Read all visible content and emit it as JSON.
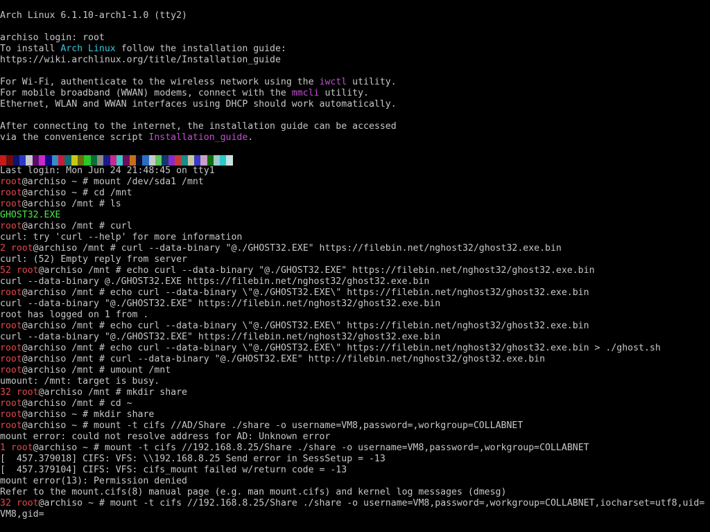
{
  "colors": {
    "text": "#c8c8c8",
    "background": "#000000",
    "prompt_user": "#e5484d",
    "exit_code": "#e5484d",
    "directory_entry": "#4ee84e",
    "distro_highlight": "#38c6d9",
    "utility_highlight": "#c050d0"
  },
  "banner": {
    "kernel": "Arch Linux 6.1.10-arch1-1.0 (tty2)",
    "login": "archiso login: root",
    "install_pre": "To install ",
    "install_distro": "Arch Linux",
    "install_post": " follow the installation guide:",
    "guide_url": "https://wiki.archlinux.org/title/Installation_guide",
    "wifi_pre": "For Wi-Fi, authenticate to the wireless network using the ",
    "wifi_tool": "iwctl",
    "wifi_post": " utility.",
    "wwan_pre": "For mobile broadband (WWAN) modems, connect with the ",
    "wwan_tool": "mmcli",
    "wwan_post": " utility.",
    "ethernet": "Ethernet, WLAN and WWAN interfaces using DHCP should work automatically.",
    "after_1": "After connecting to the internet, the installation guide can be accessed",
    "after_2_pre": "via the convenience script ",
    "after_2_tool": "Installation_guide",
    "after_2_post": "."
  },
  "palette_swatches": [
    "#c41a1a",
    "#6d0c0c",
    "#0c146d",
    "#2a3ac8",
    "#c8c8c8",
    "#5a0c6d",
    "#c82ac8",
    "#0c0c8a",
    "#3a8ac8",
    "#c81a3a",
    "#0c6d6d",
    "#c8c814",
    "#6d6d0c",
    "#2ac82a",
    "#0c6d3a",
    "#8a8a8a",
    "#1a1a8a",
    "#c82a8a",
    "#3ac8c8",
    "#6d0c5a",
    "#c86d1a",
    "#0c0c2a",
    "#2a6dc8",
    "#c8c8c8",
    "#5ac85a",
    "#0c3a6d",
    "#8a2ac8",
    "#c83a3a",
    "#1a8a8a",
    "#c8c8a0",
    "#3a3ac8",
    "#c8a0c8",
    "#0c6d0c",
    "#a0c8c8",
    "#2ac8c8",
    "#c8e0e0"
  ],
  "lines": [
    {
      "text": "Last login: Mon Jun 24 21:48:45 on tty1"
    },
    {
      "exit": "",
      "user": "root",
      "host": "@archiso",
      "cwd": " ~ ",
      "cmd": "# mount /dev/sda1 /mnt"
    },
    {
      "exit": "",
      "user": "root",
      "host": "@archiso",
      "cwd": " ~ ",
      "cmd": "# cd /mnt"
    },
    {
      "exit": "",
      "user": "root",
      "host": "@archiso",
      "cwd": " /mnt ",
      "cmd": "# ls"
    },
    {
      "entry": "GHOST32.EXE"
    },
    {
      "exit": "",
      "user": "root",
      "host": "@archiso",
      "cwd": " /mnt ",
      "cmd": "# curl"
    },
    {
      "text": "curl: try 'curl --help' for more information"
    },
    {
      "exit": "2 ",
      "user": "root",
      "host": "@archiso",
      "cwd": " /mnt ",
      "cmd": "# curl --data-binary \"@./GHOST32.EXE\" https://filebin.net/nghost32/ghost32.exe.bin"
    },
    {
      "text": "curl: (52) Empty reply from server"
    },
    {
      "exit": "52 ",
      "user": "root",
      "host": "@archiso",
      "cwd": " /mnt ",
      "cmd": "# echo curl --data-binary \"@./GHOST32.EXE\" https://filebin.net/nghost32/ghost32.exe.bin"
    },
    {
      "text": "curl --data-binary @./GHOST32.EXE https://filebin.net/nghost32/ghost32.exe.bin"
    },
    {
      "exit": "",
      "user": "root",
      "host": "@archiso",
      "cwd": " /mnt ",
      "cmd": "# echo curl --data-binary \\\"@./GHOST32.EXE\\\" https://filebin.net/nghost32/ghost32.exe.bin"
    },
    {
      "text": "curl --data-binary \"@./GHOST32.EXE\" https://filebin.net/nghost32/ghost32.exe.bin"
    },
    {
      "text": "root has logged on 1 from ."
    },
    {
      "exit": "",
      "user": "root",
      "host": "@archiso",
      "cwd": " /mnt ",
      "cmd": "# echo curl --data-binary \\\"@./GHOST32.EXE\\\" https://filebin.net/nghost32/ghost32.exe.bin"
    },
    {
      "text": "curl --data-binary \"@./GHOST32.EXE\" https://filebin.net/nghost32/ghost32.exe.bin"
    },
    {
      "exit": "",
      "user": "root",
      "host": "@archiso",
      "cwd": " /mnt ",
      "cmd": "# echo curl --data-binary \\\"@./GHOST32.EXE\\\" https://filebin.net/nghost32/ghost32.exe.bin > ./ghost.sh"
    },
    {
      "exit": "",
      "user": "root",
      "host": "@archiso",
      "cwd": " /mnt ",
      "cmd": "# curl --data-binary \"@./GHOST32.EXE\" http://filebin.net/nghost32/ghost32.exe.bin"
    },
    {
      "exit": "",
      "user": "root",
      "host": "@archiso",
      "cwd": " /mnt ",
      "cmd": "# umount /mnt"
    },
    {
      "text": "umount: /mnt: target is busy."
    },
    {
      "exit": "32 ",
      "user": "root",
      "host": "@archiso",
      "cwd": " /mnt ",
      "cmd": "# mkdir share"
    },
    {
      "exit": "",
      "user": "root",
      "host": "@archiso",
      "cwd": " /mnt ",
      "cmd": "# cd ~"
    },
    {
      "exit": "",
      "user": "root",
      "host": "@archiso",
      "cwd": " ~ ",
      "cmd": "# mkdir share"
    },
    {
      "exit": "",
      "user": "root",
      "host": "@archiso",
      "cwd": " ~ ",
      "cmd": "# mount -t cifs //AD/Share ./share -o username=VM8,password=,workgroup=COLLABNET"
    },
    {
      "text": "mount error: could not resolve address for AD: Unknown error"
    },
    {
      "exit": "1 ",
      "user": "root",
      "host": "@archiso",
      "cwd": " ~ ",
      "cmd": "# mount -t cifs //192.168.8.25/Share ./share -o username=VM8,password=,workgroup=COLLABNET"
    },
    {
      "text": "[  457.379018] CIFS: VFS: \\\\192.168.8.25 Send error in SessSetup = -13"
    },
    {
      "text": "[  457.379104] CIFS: VFS: cifs_mount failed w/return code = -13"
    },
    {
      "text": "mount error(13): Permission denied"
    },
    {
      "text": "Refer to the mount.cifs(8) manual page (e.g. man mount.cifs) and kernel log messages (dmesg)"
    },
    {
      "exit": "32 ",
      "user": "root",
      "host": "@archiso",
      "cwd": " ~ ",
      "cmd": "# mount -t cifs //192.168.8.25/Share ./share -o username=VM8,password=,workgroup=COLLABNET,iocharset=utf8,uid="
    },
    {
      "text": "VM8,gid="
    }
  ]
}
